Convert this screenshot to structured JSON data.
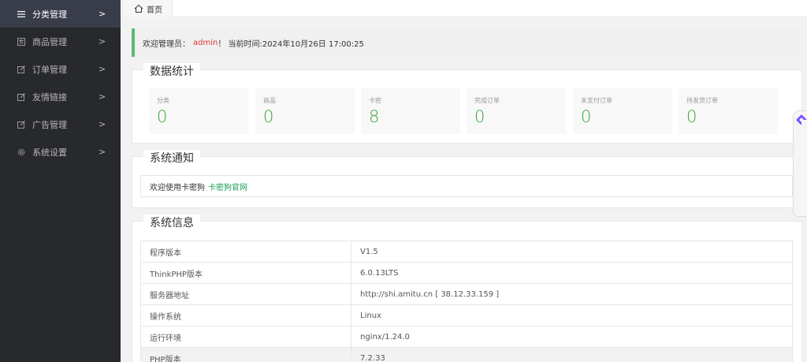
{
  "sidebar": {
    "items": [
      {
        "label": "分类管理",
        "icon": "menu-icon",
        "active": true
      },
      {
        "label": "商品管理",
        "icon": "goods-icon",
        "active": false
      },
      {
        "label": "订单管理",
        "icon": "edit-icon",
        "active": false
      },
      {
        "label": "友情链接",
        "icon": "edit-icon",
        "active": false
      },
      {
        "label": "广告管理",
        "icon": "edit-icon",
        "active": false
      },
      {
        "label": "系统设置",
        "icon": "gear-icon",
        "active": false
      }
    ],
    "arrow": ">"
  },
  "tabbar": {
    "home_label": "首页"
  },
  "welcome": {
    "prefix": "欢迎管理员：",
    "user": "admin",
    "suffix": "！ 当前时间:2024年10月26日 17:00:25"
  },
  "stats": {
    "title": "数据统计",
    "items": [
      {
        "label": "分类",
        "value": "0"
      },
      {
        "label": "商品",
        "value": "0"
      },
      {
        "label": "卡密",
        "value": "8"
      },
      {
        "label": "完成订单",
        "value": "0"
      },
      {
        "label": "未支付订单",
        "value": "0"
      },
      {
        "label": "待发货订单",
        "value": "0"
      }
    ]
  },
  "notice": {
    "title": "系统通知",
    "text": "欢迎使用卡密狗",
    "link": "卡密狗官网"
  },
  "sysinfo": {
    "title": "系统信息",
    "rows": [
      {
        "key": "程序版本",
        "value": "V1.5"
      },
      {
        "key": "ThinkPHP版本",
        "value": "6.0.13LTS"
      },
      {
        "key": "服务器地址",
        "value": "http://shi.amitu.cn [ 38.12.33.159 ]"
      },
      {
        "key": "操作系统",
        "value": "Linux"
      },
      {
        "key": "运行环境",
        "value": "nginx/1.24.0"
      },
      {
        "key": "PHP版本",
        "value": "7.2.33"
      }
    ]
  },
  "colors": {
    "accent_green": "#3aa63a",
    "sidebar_bg": "#28292c",
    "admin_red": "#e2333a"
  }
}
